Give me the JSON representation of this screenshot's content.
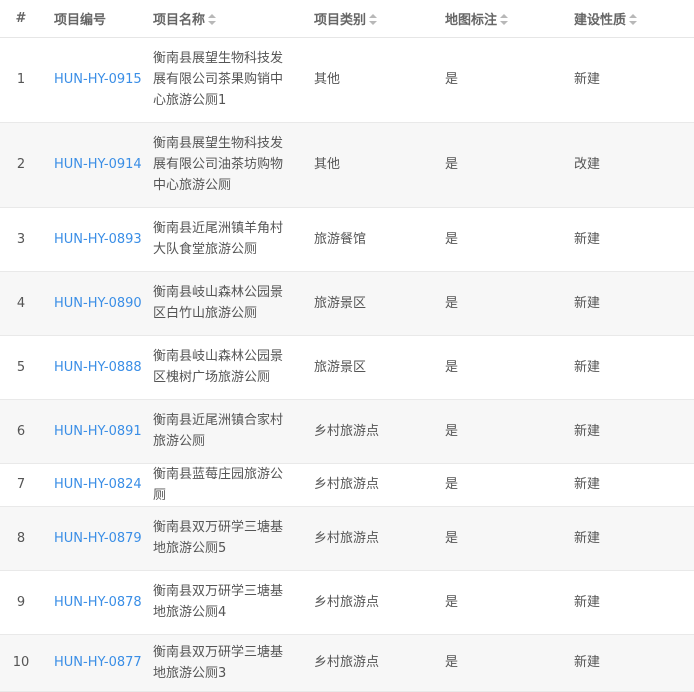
{
  "columns": {
    "index": "#",
    "code": "项目编号",
    "name": "项目名称",
    "type": "项目类别",
    "map": "地图标注",
    "nature": "建设性质"
  },
  "icons": {
    "sort": "sort-icon"
  },
  "colors": {
    "link": "#3a8ee6",
    "row_alt": "#f7f7f7"
  },
  "rows": [
    {
      "index": "1",
      "code": "HUN-HY-0915",
      "name": "衡南县展望生物科技发展有限公司茶果购销中心旅游公厕1",
      "type": "其他",
      "map": "是",
      "nature": "新建"
    },
    {
      "index": "2",
      "code": "HUN-HY-0914",
      "name": "衡南县展望生物科技发展有限公司油茶坊购物中心旅游公厕",
      "type": "其他",
      "map": "是",
      "nature": "改建"
    },
    {
      "index": "3",
      "code": "HUN-HY-0893",
      "name": "衡南县近尾洲镇羊角村大队食堂旅游公厕",
      "type": "旅游餐馆",
      "map": "是",
      "nature": "新建"
    },
    {
      "index": "4",
      "code": "HUN-HY-0890",
      "name": "衡南县岐山森林公园景区白竹山旅游公厕",
      "type": "旅游景区",
      "map": "是",
      "nature": "新建"
    },
    {
      "index": "5",
      "code": "HUN-HY-0888",
      "name": "衡南县岐山森林公园景区槐树广场旅游公厕",
      "type": "旅游景区",
      "map": "是",
      "nature": "新建"
    },
    {
      "index": "6",
      "code": "HUN-HY-0891",
      "name": "衡南县近尾洲镇合家村旅游公厕",
      "type": "乡村旅游点",
      "map": "是",
      "nature": "新建"
    },
    {
      "index": "7",
      "code": "HUN-HY-0824",
      "name": "衡南县蓝莓庄园旅游公厕",
      "type": "乡村旅游点",
      "map": "是",
      "nature": "新建"
    },
    {
      "index": "8",
      "code": "HUN-HY-0879",
      "name": "衡南县双万研学三塘基地旅游公厕5",
      "type": "乡村旅游点",
      "map": "是",
      "nature": "新建"
    },
    {
      "index": "9",
      "code": "HUN-HY-0878",
      "name": "衡南县双万研学三塘基地旅游公厕4",
      "type": "乡村旅游点",
      "map": "是",
      "nature": "新建"
    },
    {
      "index": "10",
      "code": "HUN-HY-0877",
      "name": "衡南县双万研学三塘基地旅游公厕3",
      "type": "乡村旅游点",
      "map": "是",
      "nature": "新建"
    }
  ]
}
